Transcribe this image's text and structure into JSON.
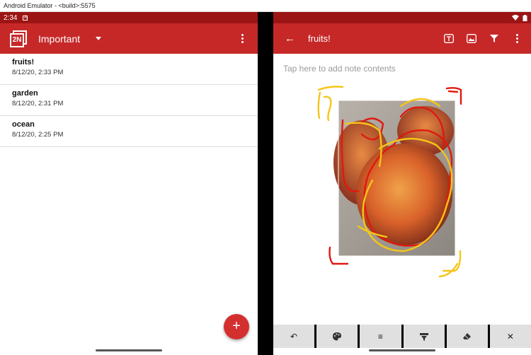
{
  "window": {
    "title": "Android Emulator - <build>:5575"
  },
  "status_bar": {
    "time": "2:34"
  },
  "left_pane": {
    "logo_text": "2N",
    "filter_label": "Important",
    "notes": [
      {
        "title": "fruits!",
        "date": "8/12/20, 2:33 PM"
      },
      {
        "title": "garden",
        "date": "8/12/20, 2:31 PM"
      },
      {
        "title": "ocean",
        "date": "8/12/20, 2:25 PM"
      }
    ],
    "fab_label": "+"
  },
  "right_pane": {
    "note_title": "fruits!",
    "placeholder": "Tap here to add note contents",
    "back_glyph": "←",
    "toolbar_icons": [
      "text-icon",
      "image-icon",
      "filter-icon",
      "more-icon"
    ],
    "bottom_buttons": [
      {
        "name": "undo-button",
        "glyph": "↶"
      },
      {
        "name": "palette-button",
        "glyph": "🎨"
      },
      {
        "name": "lines-button",
        "glyph": "≡"
      },
      {
        "name": "highlighter-button",
        "glyph": "▾"
      },
      {
        "name": "eraser-button",
        "glyph": "◆"
      },
      {
        "name": "close-button",
        "glyph": "✕"
      }
    ]
  },
  "colors": {
    "app_bar": "#c62828",
    "status_bar": "#9c1515",
    "accent": "#d32f2f",
    "ink_red": "#e0190f",
    "ink_yellow": "#f5c518"
  }
}
